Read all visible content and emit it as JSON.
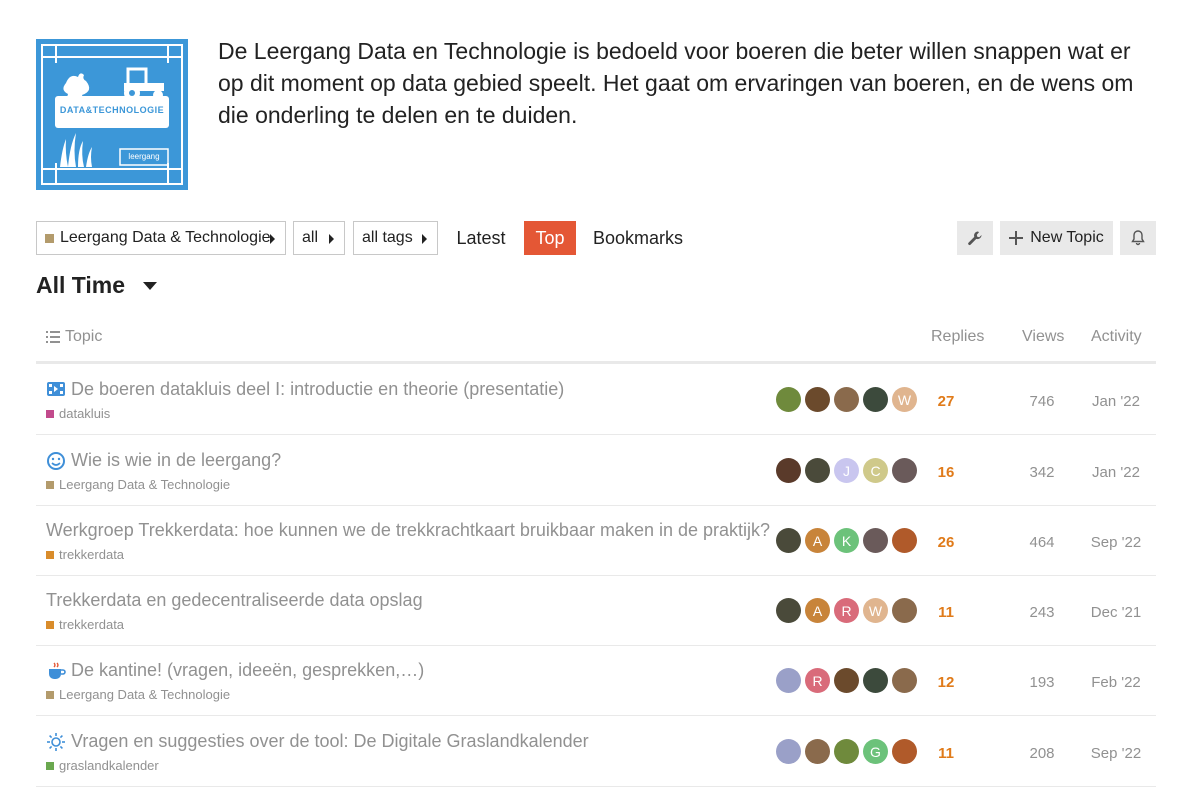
{
  "header": {
    "logo_text": "DATA&TECHNOLOGIE",
    "logo_subtext": "leergang",
    "description": "De Leergang Data en Technologie is bedoeld voor boeren die beter willen snappen wat er op dit moment op data gebied speelt. Het gaat om ervaringen van boeren, en de wens om die onderling te delen en te duiden."
  },
  "nav": {
    "category_dropdown": "Leergang Data & Technologie",
    "subcategory_dropdown": "all",
    "tags_dropdown": "all tags",
    "latest": "Latest",
    "top": "Top",
    "bookmarks": "Bookmarks",
    "new_topic": "New Topic",
    "active_tab": "Top",
    "accent_color": "#e45735"
  },
  "period": "All Time",
  "columns": {
    "topic": "Topic",
    "replies": "Replies",
    "views": "Views",
    "activity": "Activity"
  },
  "topics": [
    {
      "title": "De boeren datakluis deel I: introductie en theorie (presentatie)",
      "icon": "video-icon",
      "category": "datakluis",
      "category_color": "#c24a8c",
      "avatars": [
        {
          "initial": "",
          "color": "#6f8a3c"
        },
        {
          "initial": "",
          "color": "#6b4a2c"
        },
        {
          "initial": "",
          "color": "#8a6a4c"
        },
        {
          "initial": "",
          "color": "#3c4a3c"
        },
        {
          "initial": "W",
          "color": "#e0b58f"
        }
      ],
      "replies": "27",
      "views": "746",
      "activity": "Jan '22"
    },
    {
      "title": "Wie is wie in de leergang?",
      "icon": "smiley-icon",
      "category": "Leergang Data & Technologie",
      "category_color": "#b39b6c",
      "avatars": [
        {
          "initial": "",
          "color": "#5a3a2a"
        },
        {
          "initial": "",
          "color": "#4a4a3a"
        },
        {
          "initial": "J",
          "color": "#c9c6ef"
        },
        {
          "initial": "C",
          "color": "#cfc98a"
        },
        {
          "initial": "",
          "color": "#6a5a5a"
        }
      ],
      "replies": "16",
      "views": "342",
      "activity": "Jan '22"
    },
    {
      "title": "Werkgroep Trekkerdata: hoe kunnen we de trekkrachtkaart bruikbaar maken in de praktijk?",
      "icon": "",
      "category": "trekkerdata",
      "category_color": "#d98c2b",
      "avatars": [
        {
          "initial": "",
          "color": "#4a4a3a"
        },
        {
          "initial": "A",
          "color": "#c8843a"
        },
        {
          "initial": "K",
          "color": "#6cc27a"
        },
        {
          "initial": "",
          "color": "#6a5a5a"
        },
        {
          "initial": "",
          "color": "#b05a2a"
        }
      ],
      "replies": "26",
      "views": "464",
      "activity": "Sep '22"
    },
    {
      "title": "Trekkerdata en gedecentraliseerde data opslag",
      "icon": "",
      "category": "trekkerdata",
      "category_color": "#d98c2b",
      "avatars": [
        {
          "initial": "",
          "color": "#4a4a3a"
        },
        {
          "initial": "A",
          "color": "#c8843a"
        },
        {
          "initial": "R",
          "color": "#d96b7a"
        },
        {
          "initial": "W",
          "color": "#e0b58f"
        },
        {
          "initial": "",
          "color": "#8a6a4c"
        }
      ],
      "replies": "11",
      "views": "243",
      "activity": "Dec '21"
    },
    {
      "title": "De kantine! (vragen, ideeën, gesprekken,…)",
      "icon": "coffee-icon",
      "category": "Leergang Data & Technologie",
      "category_color": "#b39b6c",
      "avatars": [
        {
          "initial": "",
          "color": "#9aa0c8"
        },
        {
          "initial": "R",
          "color": "#d96b7a"
        },
        {
          "initial": "",
          "color": "#6b4a2c"
        },
        {
          "initial": "",
          "color": "#3c4a3c"
        },
        {
          "initial": "",
          "color": "#8a6a4c"
        }
      ],
      "replies": "12",
      "views": "193",
      "activity": "Feb '22"
    },
    {
      "title": "Vragen en suggesties over de tool: De Digitale Graslandkalender",
      "icon": "lightbulb-icon",
      "category": "graslandkalender",
      "category_color": "#6aa84f",
      "avatars": [
        {
          "initial": "",
          "color": "#9aa0c8"
        },
        {
          "initial": "",
          "color": "#8a6a4c"
        },
        {
          "initial": "",
          "color": "#6f8a3c"
        },
        {
          "initial": "G",
          "color": "#6cc27a"
        },
        {
          "initial": "",
          "color": "#b05a2a"
        }
      ],
      "replies": "11",
      "views": "208",
      "activity": "Sep '22"
    }
  ]
}
